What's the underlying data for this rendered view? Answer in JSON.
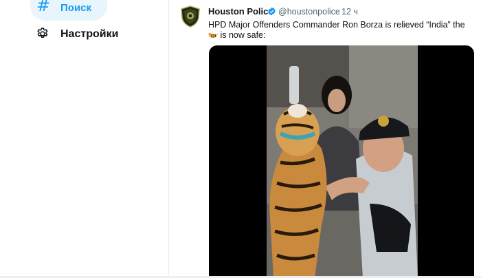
{
  "nav": {
    "search": {
      "icon": "hashtag-icon",
      "glyph": "#",
      "label": "Поиск",
      "color": "#1d9bf0"
    },
    "settings": {
      "icon": "gear-icon",
      "label": "Настройки"
    }
  },
  "tweet": {
    "author": "Houston Police",
    "handle": "@houstonpolice",
    "separator": "·",
    "time": "12 ч",
    "verified": true,
    "text_before_emoji": "HPD Major Offenders Commander Ron Borza is relieved “India” the ",
    "emoji": "tiger-emoji",
    "text_after_emoji": " is now safe:",
    "media": {
      "type": "video",
      "description_icon": "video-thumbnail"
    }
  },
  "colors": {
    "accent": "#1d9bf0",
    "text": "#0f1419",
    "muted": "#536471",
    "active_bg": "#e8f5fd"
  }
}
